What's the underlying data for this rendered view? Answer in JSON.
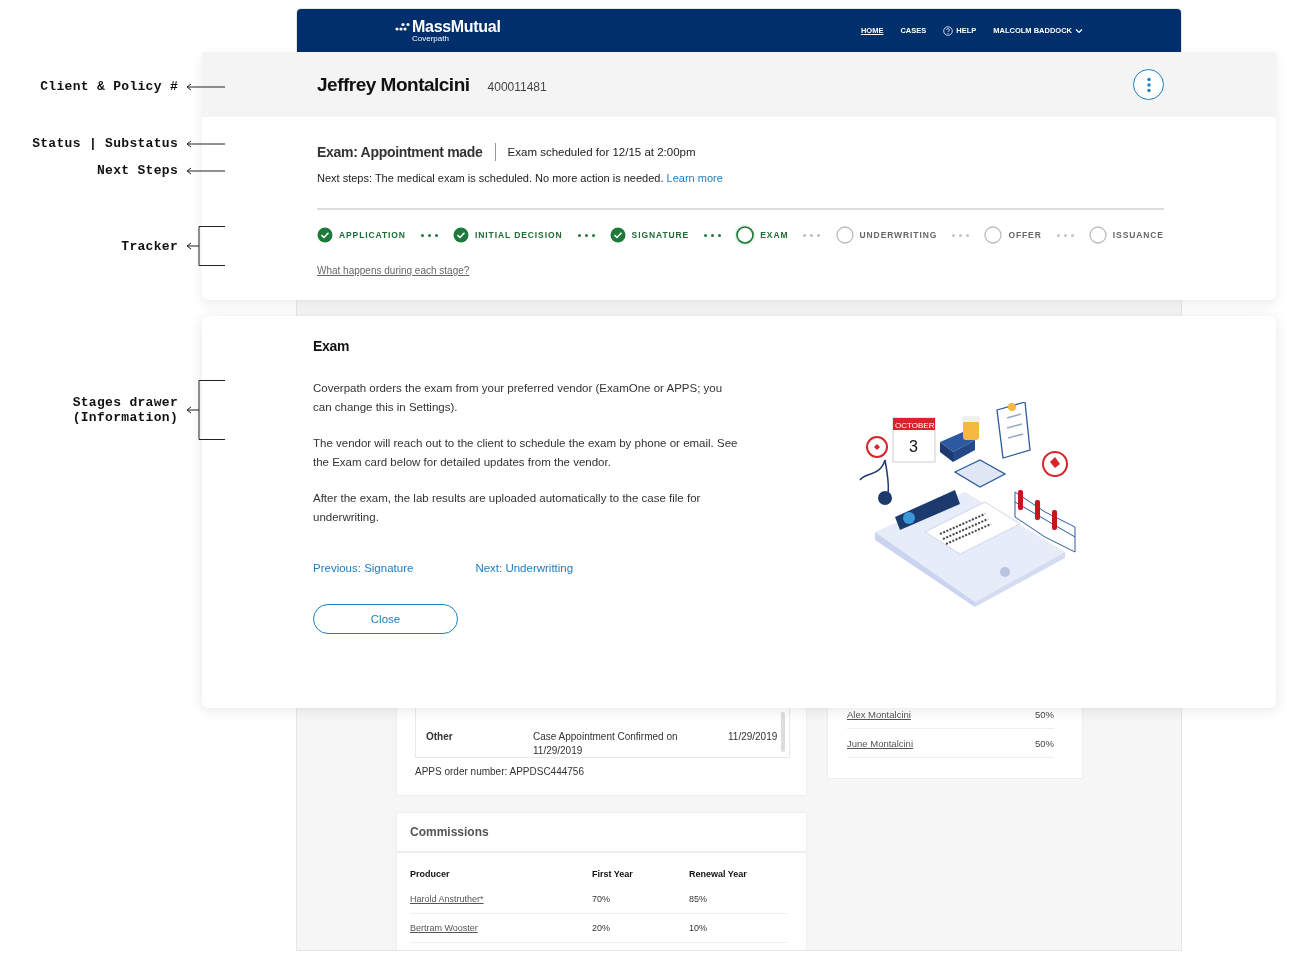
{
  "annotations": [
    {
      "label": "Client & Policy #",
      "kind": "arrow"
    },
    {
      "label": "Status | Substatus",
      "kind": "arrow"
    },
    {
      "label": "Next Steps",
      "kind": "arrow"
    },
    {
      "label": "Tracker",
      "kind": "bracket"
    },
    {
      "label": "Stages drawer\n(Information)",
      "kind": "bracket"
    }
  ],
  "nav": {
    "logo": "MassMutual",
    "product": "Coverpath",
    "links": [
      {
        "label": "HOME",
        "kind": "plain",
        "selected": true
      },
      {
        "label": "CASES",
        "kind": "plain",
        "selected": false
      },
      {
        "label": "HELP",
        "kind": "help",
        "selected": false
      }
    ],
    "user": "MALCOLM BADDOCK"
  },
  "client": {
    "name": "Jeffrey Montalcini",
    "policy": "400011481"
  },
  "status": {
    "status": "Exam: Appointment made",
    "substatus": "Exam scheduled for 12/15 at 2:00pm",
    "next_label": "Next steps:",
    "next_text": "The medical exam is scheduled. No more action is needed.",
    "next_link": "Learn more"
  },
  "tracker": {
    "stages": [
      {
        "label": "APPLICATION",
        "completed": true,
        "selected": false
      },
      {
        "label": "INITIAL DECISION",
        "completed": true,
        "selected": false
      },
      {
        "label": "SIGNATURE",
        "completed": true,
        "selected": false
      },
      {
        "label": "EXAM",
        "completed": false,
        "selected": true
      },
      {
        "label": "UNDERWRITING",
        "completed": false,
        "selected": false
      },
      {
        "label": "OFFER",
        "completed": false,
        "selected": false
      },
      {
        "label": "ISSUANCE",
        "completed": false,
        "selected": false
      }
    ],
    "link": "What happens during each stage?"
  },
  "drawer": {
    "title": "Exam",
    "paragraphs": [
      "Coverpath orders the exam from your preferred vendor (ExamOne or APPS; you can change this in Settings).",
      "The vendor will reach out to the client to schedule the exam by phone or email. See the Exam card below for detailed updates from the vendor.",
      "After the exam, the lab results are uploaded automatically to the case file for underwriting."
    ],
    "previous": "Previous: Signature",
    "next": "Next: Underwritting",
    "close": "Close",
    "illustration": {
      "calendar_month": "OCTOBER",
      "calendar_day": "3"
    }
  },
  "exam_updates": {
    "rows": [
      {
        "type": "Other",
        "description": "Case Appointment Confirmed on 11/29/2019",
        "date": "11/29/2019"
      }
    ],
    "order": "APPS order number: APPDSC444756"
  },
  "beneficiaries": [
    {
      "name": "Alex Montalcini",
      "share": "50%"
    },
    {
      "name": "June Montalcini",
      "share": "50%"
    }
  ],
  "commissions": {
    "title": "Commissions",
    "columns": [
      "Producer",
      "First Year",
      "Renewal Year"
    ],
    "rows": [
      [
        "Harold Anstruther*",
        "70%",
        "85%"
      ],
      [
        "Bertram Wooster",
        "20%",
        "10%"
      ]
    ]
  }
}
